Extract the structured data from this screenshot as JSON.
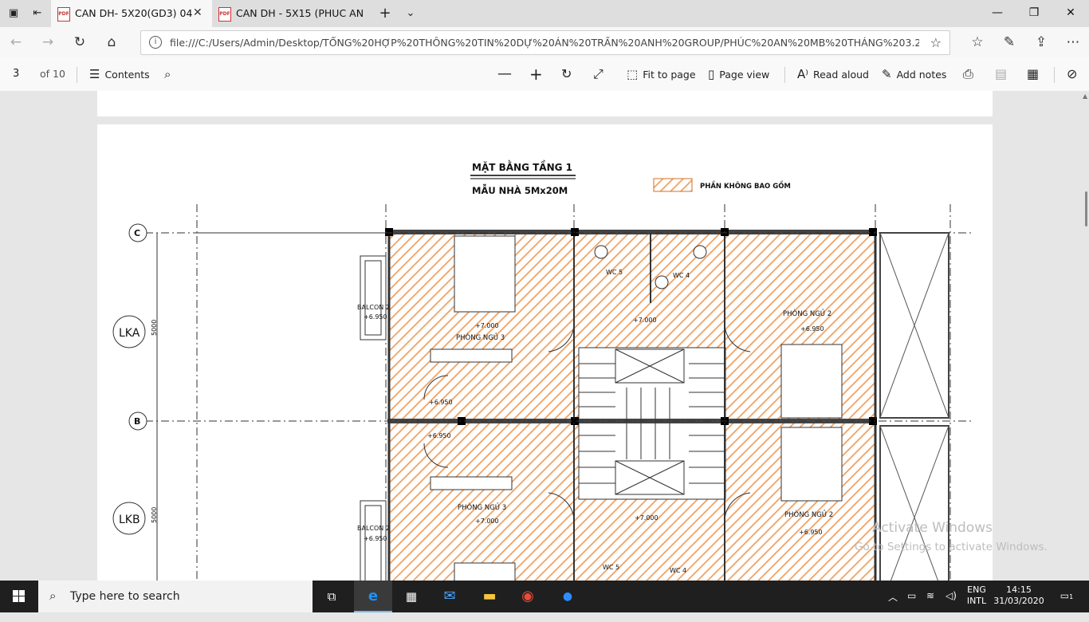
{
  "tabs": [
    {
      "title": "CAN DH- 5X20(GD3) 04",
      "active": true
    },
    {
      "title": "CAN DH - 5X15 (PHUC AN (",
      "active": false
    }
  ],
  "address": {
    "url": "file:///C:/Users/Admin/Desktop/T%E1%BB%94NG%20H%E1%BB%A2P%20TH%C3%94NG%20TIN%20D%E1%BB%B0%20%C3%81N%20TR%E1%BA%A6N%20ANH%20GROUP/PH%C3%9AC%20AN%20MB%20TH%C3%81NG%203.2020/CAN%"
  },
  "url_display": "file:///C:/Users/Admin/Desktop/TỔNG%20HỢP%20THÔNG%20TIN%20DỰ%20ÁN%20TRẦN%20ANH%20GROUP/PHÚC%20AN%20MB%20THÁNG%203.2020/CAN%",
  "pdf_toolbar": {
    "page": "3",
    "of": "of 10",
    "contents": "Contents",
    "fit": "Fit to page",
    "pageview": "Page view",
    "read": "Read aloud",
    "notes": "Add notes"
  },
  "drawing": {
    "title": "MẶT BẰNG TẦNG 1",
    "subtitle": "MẪU NHÀ  5Mx20M",
    "legend": "PHẦN KHÔNG BAO GỒM",
    "axis_c": "C",
    "axis_b": "B",
    "lka": "LKA",
    "lkb": "LKB",
    "dim": "5000",
    "balcon1": "BALCON 2",
    "balcon2": "BALCON 2",
    "lvl1": "+6.950",
    "lvl2": "+6.950",
    "room1": "PHÒNG NGỦ 3",
    "room2": "PHÒNG NGỦ 2",
    "room3": "PHÒNG NGỦ 3",
    "room4": "PHÒNG NGỦ 2",
    "wc5": "WC 5",
    "wc4": "WC 4",
    "wc5b": "WC 5",
    "wc4b": "WC 4",
    "plus7a": "+7.000",
    "plus7b": "+7.000",
    "plus7c": "+7.000",
    "plus7d": "+7.000",
    "plus695a": "+6.950",
    "plus695b": "+6.950",
    "plus695c": "+6.950",
    "plus695d": "+6.950"
  },
  "watermark": {
    "line1": "Activate Windows",
    "line2": "Go to Settings to activate Windows."
  },
  "taskbar": {
    "search": "Type here to search",
    "lang1": "ENG",
    "lang2": "INTL",
    "time": "14:15",
    "date": "31/03/2020",
    "notif": "1"
  }
}
